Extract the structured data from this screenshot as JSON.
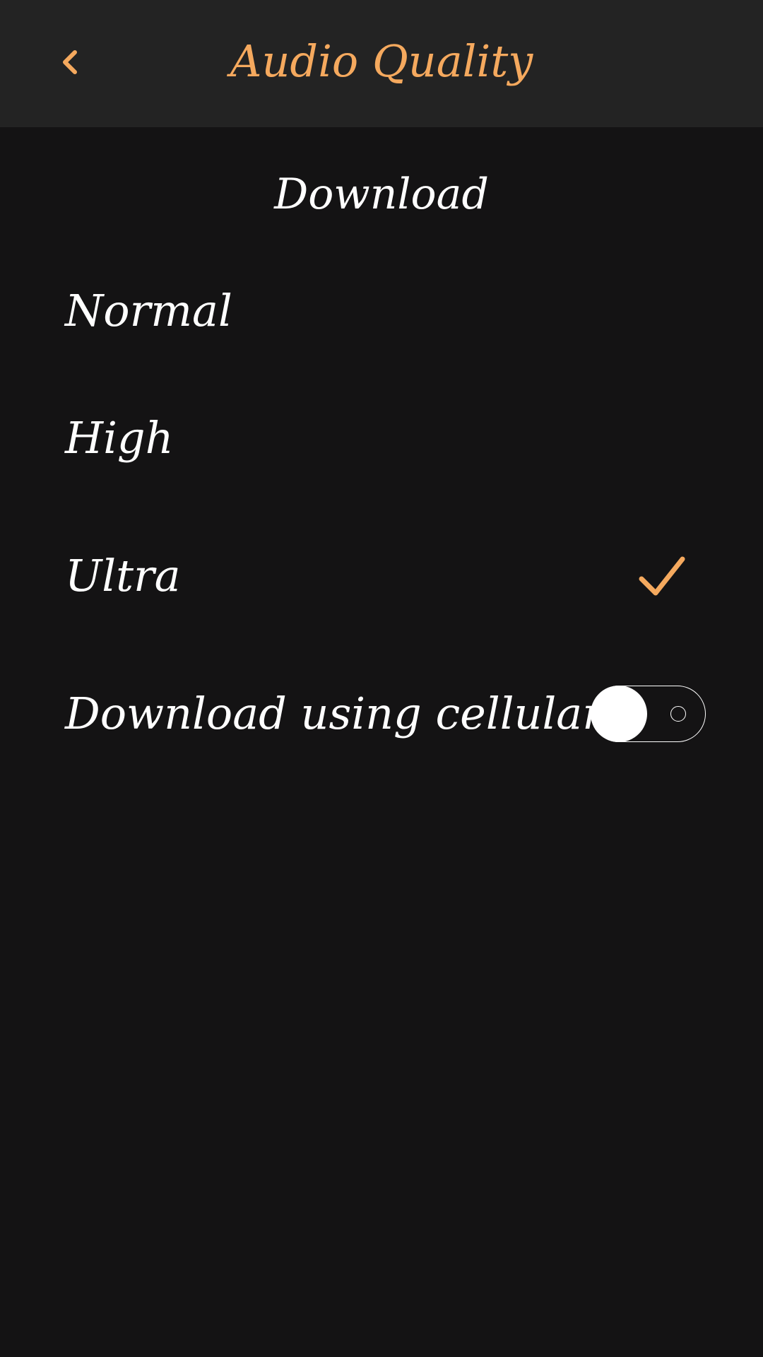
{
  "header": {
    "title": "Audio Quality",
    "back_icon": "chevron-left-icon"
  },
  "section": {
    "title": "Download"
  },
  "options": [
    {
      "label": "Normal",
      "selected": false
    },
    {
      "label": "High",
      "selected": false
    },
    {
      "label": "Ultra",
      "selected": true
    }
  ],
  "cellular": {
    "label": "Download using cellular",
    "enabled": false
  },
  "colors": {
    "accent": "#F5A95E",
    "background": "#141314",
    "header_background": "#232323",
    "text": "#FFFFFF"
  }
}
